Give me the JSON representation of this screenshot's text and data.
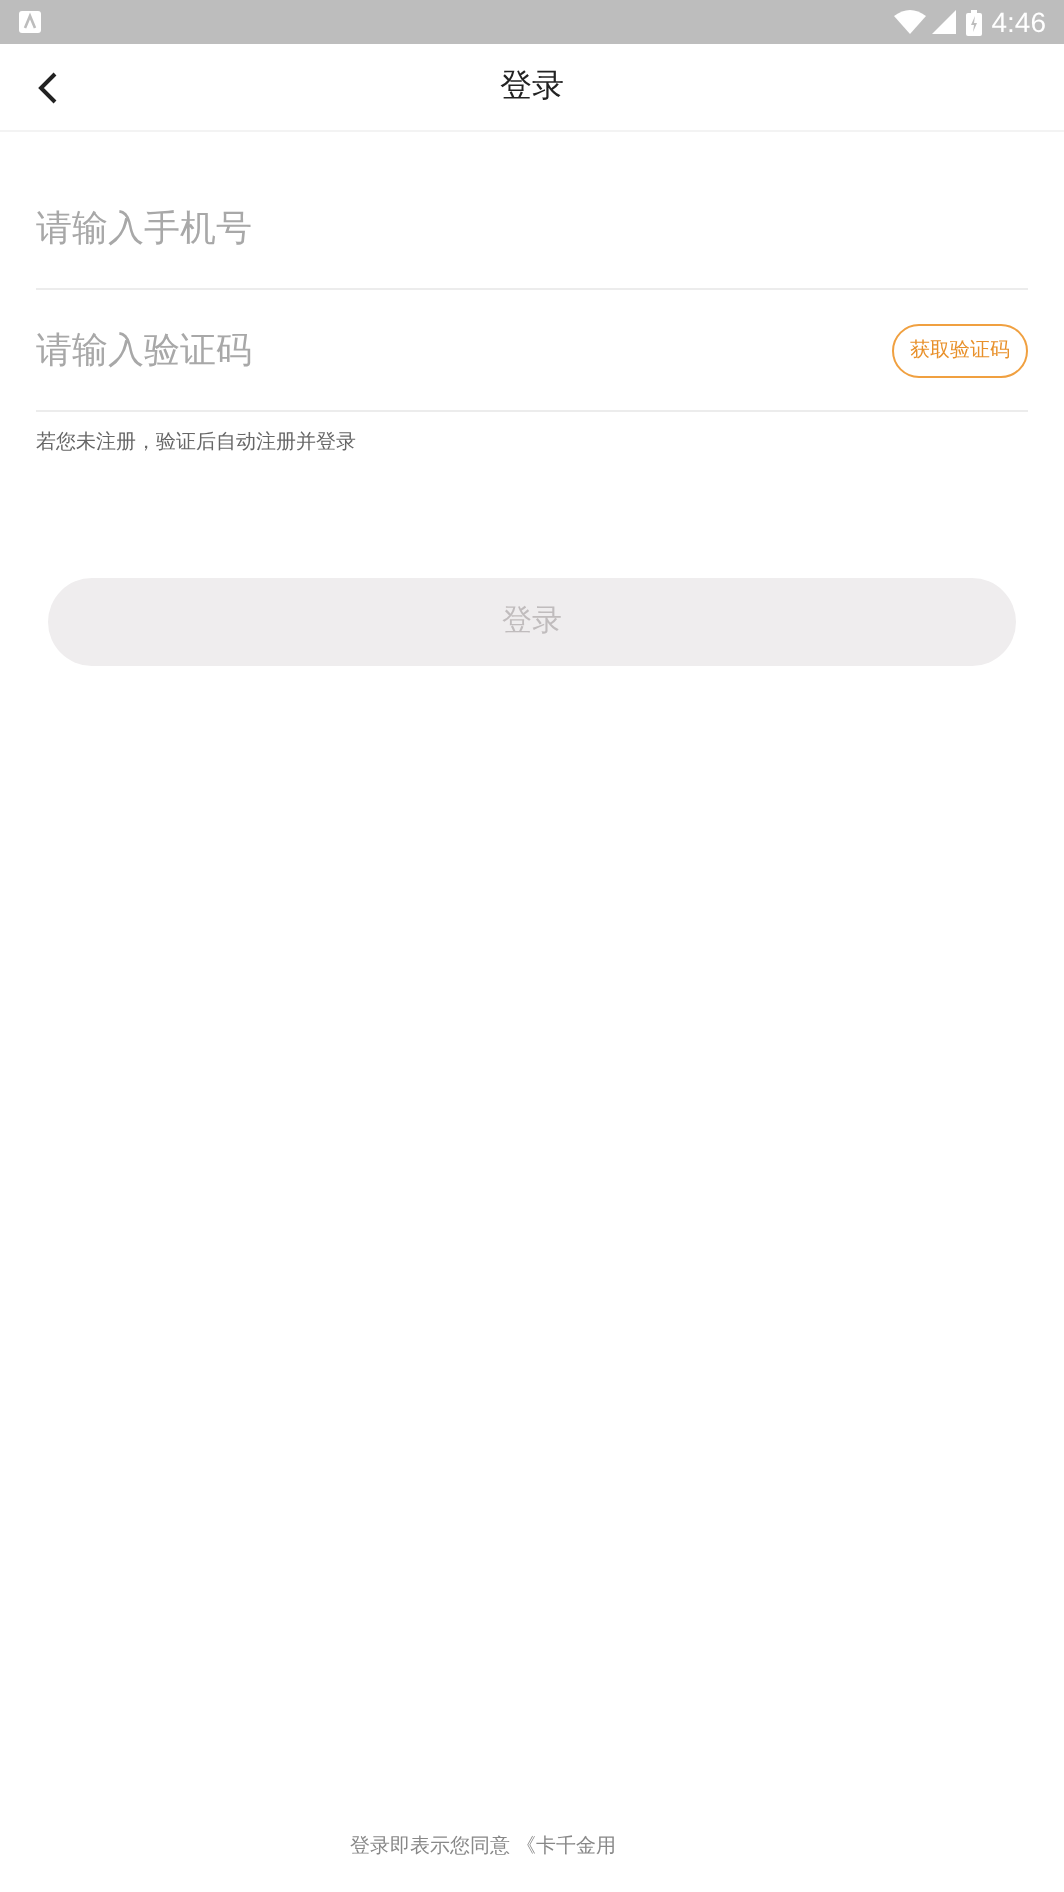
{
  "status_bar": {
    "time": "4:46"
  },
  "header": {
    "title": "登录"
  },
  "phone_field": {
    "placeholder": "请输入手机号"
  },
  "code_field": {
    "placeholder": "请输入验证码"
  },
  "get_code_button": {
    "label": "获取验证码"
  },
  "hint": "若您未注册，验证后自动注册并登录",
  "login_button": {
    "label": "登录",
    "disabled": true
  },
  "agreement": "登录即表示您同意 《卡千金用"
}
